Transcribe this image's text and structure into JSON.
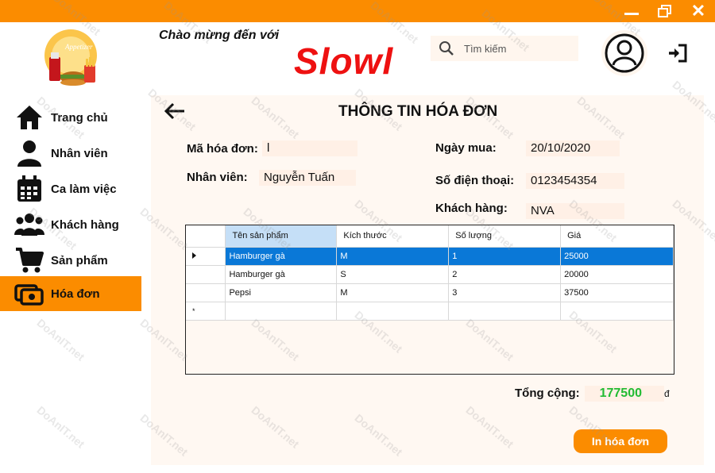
{
  "app": {
    "welcome": "Chào mừng đến với",
    "brand": "Slowl",
    "brand_color": "#ee1111",
    "accent_color": "#fb8c00"
  },
  "window_controls": [
    "minimize-icon",
    "maximize-icon",
    "close-icon"
  ],
  "search": {
    "placeholder": "Tìm kiếm"
  },
  "sidebar": {
    "items": [
      {
        "label": "Trang chủ",
        "icon": "home-icon",
        "active": false
      },
      {
        "label": "Nhân viên",
        "icon": "user-icon",
        "active": false
      },
      {
        "label": "Ca làm việc",
        "icon": "calendar-icon",
        "active": false
      },
      {
        "label": "Khách hàng",
        "icon": "users-icon",
        "active": false
      },
      {
        "label": "Sản phẩm",
        "icon": "cart-icon",
        "active": false
      },
      {
        "label": "Hóa đơn",
        "icon": "money-icon",
        "active": true
      }
    ]
  },
  "invoice": {
    "title": "THÔNG TIN HÓA ĐƠN",
    "id_label": "Mã hóa đơn:",
    "id_value": "l",
    "employee_label": "Nhân viên:",
    "employee_value": "Nguyễn Tuấn",
    "date_label": "Ngày mua:",
    "date_value": "20/10/2020",
    "phone_label": "Số điện thoại:",
    "phone_value": "0123454354",
    "customer_label": "Khách hàng:",
    "customer_value": "NVA"
  },
  "grid": {
    "columns": [
      "Tên sản phẩm",
      "Kích thước",
      "Số lượng",
      "Giá"
    ],
    "rows": [
      [
        "Hamburger gà",
        "M",
        "1",
        "25000"
      ],
      [
        "Hamburger gà",
        "S",
        "2",
        "20000"
      ],
      [
        "Pepsi",
        "M",
        "3",
        "37500"
      ]
    ],
    "selected_row": 0,
    "new_row_marker": "*"
  },
  "total": {
    "label": "Tổng cộng:",
    "value": "177500",
    "currency": "đ"
  },
  "print_button": "In hóa đơn",
  "watermark": "DoAnIT.net"
}
